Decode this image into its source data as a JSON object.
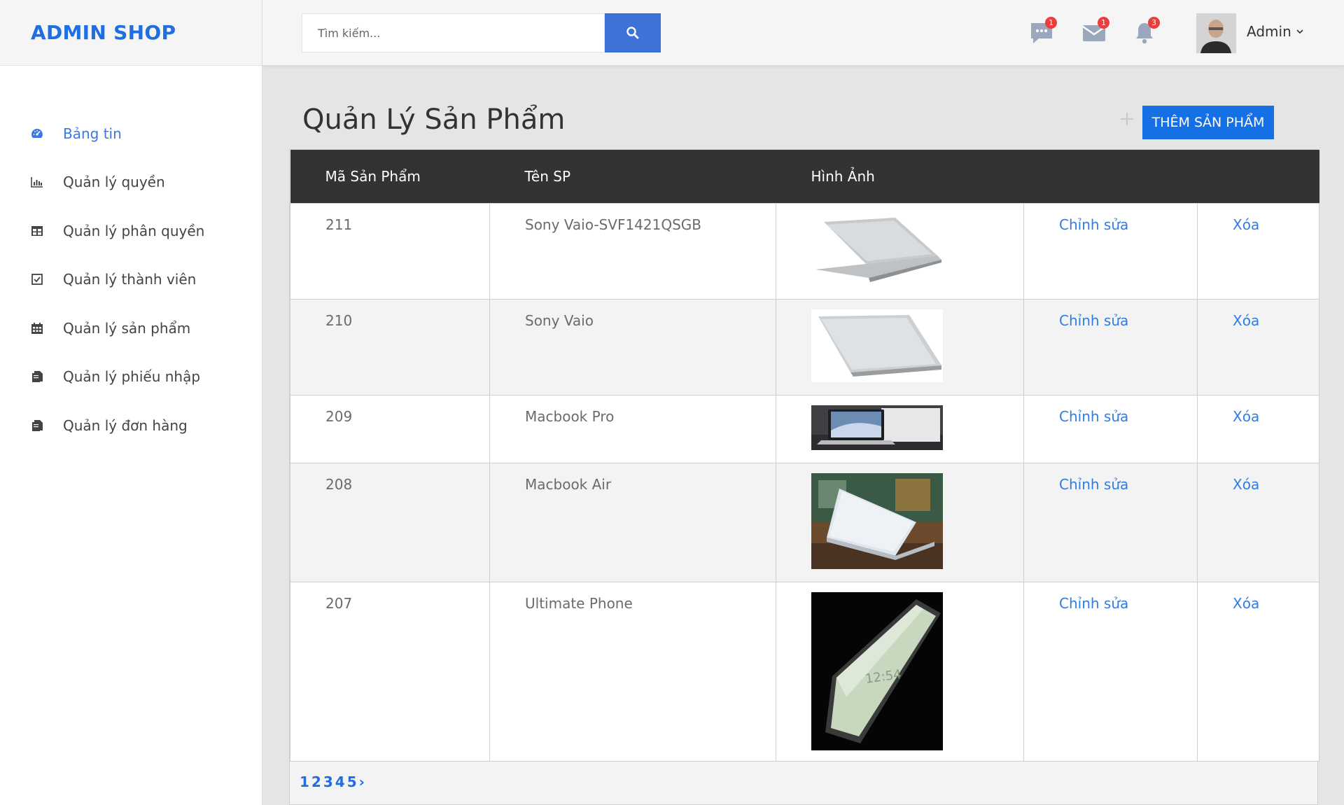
{
  "brand": {
    "name": "ADMIN SHOP"
  },
  "sidebar": {
    "items": [
      {
        "label": "Bảng tin",
        "icon": "dashboard-icon",
        "active": true
      },
      {
        "label": "Quản lý quyền",
        "icon": "bar-chart-icon"
      },
      {
        "label": "Quản lý phân quyền",
        "icon": "table-icon"
      },
      {
        "label": "Quản lý thành viên",
        "icon": "checkbox-icon"
      },
      {
        "label": "Quản lý sản phẩm",
        "icon": "calendar-icon"
      },
      {
        "label": "Quản lý phiếu nhập",
        "icon": "copy-icon"
      },
      {
        "label": "Quản lý đơn hàng",
        "icon": "copy-icon"
      }
    ]
  },
  "header": {
    "search": {
      "placeholder": "Tìm kiếm..."
    },
    "notifications": [
      {
        "icon": "chat-icon",
        "count": "1"
      },
      {
        "icon": "mail-icon",
        "count": "1"
      },
      {
        "icon": "bell-icon",
        "count": "3"
      }
    ],
    "user": {
      "name": "Admin"
    }
  },
  "main": {
    "title": "Quản Lý Sản Phẩm",
    "add_button": "THÊM SẢN PHẨM",
    "columns": [
      "Mã Sản Phẩm",
      "Tên SP",
      "Hình Ảnh",
      "",
      ""
    ],
    "rows": [
      {
        "id": "211",
        "name": "Sony Vaio-SVF1421QSGB",
        "image": "laptop-silver-icon",
        "edit": "Chỉnh sửa",
        "delete": "Xóa"
      },
      {
        "id": "210",
        "name": "Sony Vaio",
        "image": "laptop-silver-icon",
        "edit": "Chỉnh sửa",
        "delete": "Xóa"
      },
      {
        "id": "209",
        "name": "Macbook Pro",
        "image": "macbook-pro-icon",
        "edit": "Chỉnh sửa",
        "delete": "Xóa"
      },
      {
        "id": "208",
        "name": "Macbook Air",
        "image": "macbook-air-icon",
        "edit": "Chỉnh sửa",
        "delete": "Xóa"
      },
      {
        "id": "207",
        "name": "Ultimate Phone",
        "image": "phone-icon",
        "edit": "Chỉnh sửa",
        "delete": "Xóa"
      }
    ],
    "pagination": [
      "1",
      "2",
      "3",
      "4",
      "5",
      "›"
    ]
  },
  "colors": {
    "accent": "#1570e6",
    "brand": "#1f6fe0",
    "header_dark": "#333333",
    "badge": "#ee3b3b"
  }
}
